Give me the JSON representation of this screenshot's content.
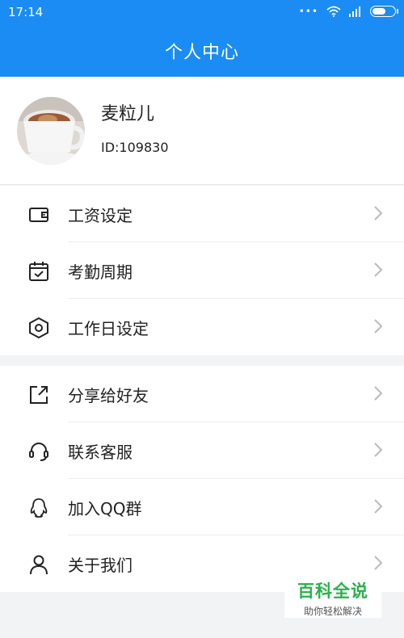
{
  "status_bar": {
    "time": "17:14",
    "icons": [
      "dots-icon",
      "wifi-icon",
      "signal-icon",
      "battery-icon"
    ]
  },
  "header": {
    "title": "个人中心"
  },
  "profile": {
    "name": "麦粒儿",
    "id": "ID:109830"
  },
  "menu_group1": [
    {
      "label": "工资设定",
      "icon": "wallet-icon"
    },
    {
      "label": "考勤周期",
      "icon": "calendar-check-icon"
    },
    {
      "label": "工作日设定",
      "icon": "hexagon-settings-icon"
    }
  ],
  "menu_group2": [
    {
      "label": "分享给好友",
      "icon": "share-icon"
    },
    {
      "label": "联系客服",
      "icon": "headset-icon"
    },
    {
      "label": "加入QQ群",
      "icon": "qq-icon"
    },
    {
      "label": "关于我们",
      "icon": "user-icon"
    }
  ],
  "watermark": {
    "title": "百科全说",
    "subtitle": "助你轻松解决"
  },
  "colors": {
    "primary": "#1a8cf4",
    "background": "#f2f3f5",
    "watermark_green": "#29b24a"
  }
}
